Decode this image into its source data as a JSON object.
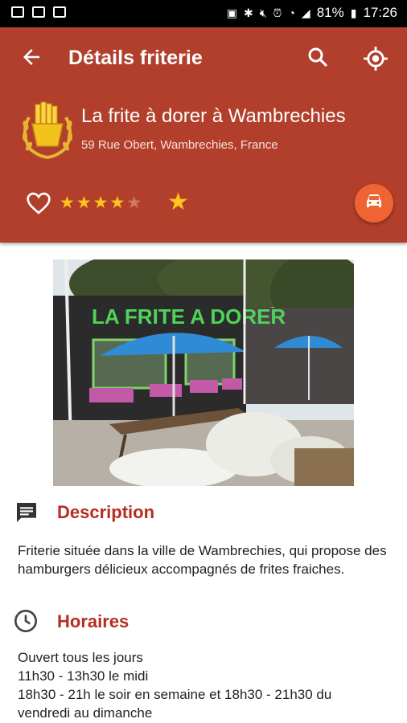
{
  "status_bar": {
    "battery": "81%",
    "time": "17:26"
  },
  "app_bar": {
    "title": "Détails friterie"
  },
  "header": {
    "name": "La frite à dorer à Wambrechies",
    "address": "59 Rue Obert, Wambrechies, France",
    "rating": 4,
    "rating_max": 5
  },
  "photo": {
    "sign_text": "LA FRITE A DORER"
  },
  "description": {
    "title": "Description",
    "text": "Friterie située dans la ville de Wambrechies, qui propose des hamburgers délicieux accompagnés de frites fraiches."
  },
  "hours": {
    "title": "Horaires",
    "lines": [
      "Ouvert tous les jours",
      "11h30 - 13h30 le midi",
      "18h30 - 21h le soir en semaine et 18h30 - 21h30 du",
      "vendredi au dimanche"
    ]
  },
  "colors": {
    "primary": "#b13f2b",
    "accent": "#f06434",
    "title_red": "#b62d20",
    "star": "#ffc61a"
  },
  "icons": [
    "image-icon",
    "gmail-icon",
    "gmail-icon",
    "battery-saver-icon",
    "bluetooth-icon",
    "mute-icon",
    "alarm-icon",
    "wifi-icon",
    "signal-icon",
    "battery-icon",
    "back-arrow-icon",
    "search-icon",
    "gps-locate-icon",
    "fries-logo-icon",
    "heart-icon",
    "star-icon",
    "car-icon",
    "comment-icon",
    "clock-icon"
  ]
}
